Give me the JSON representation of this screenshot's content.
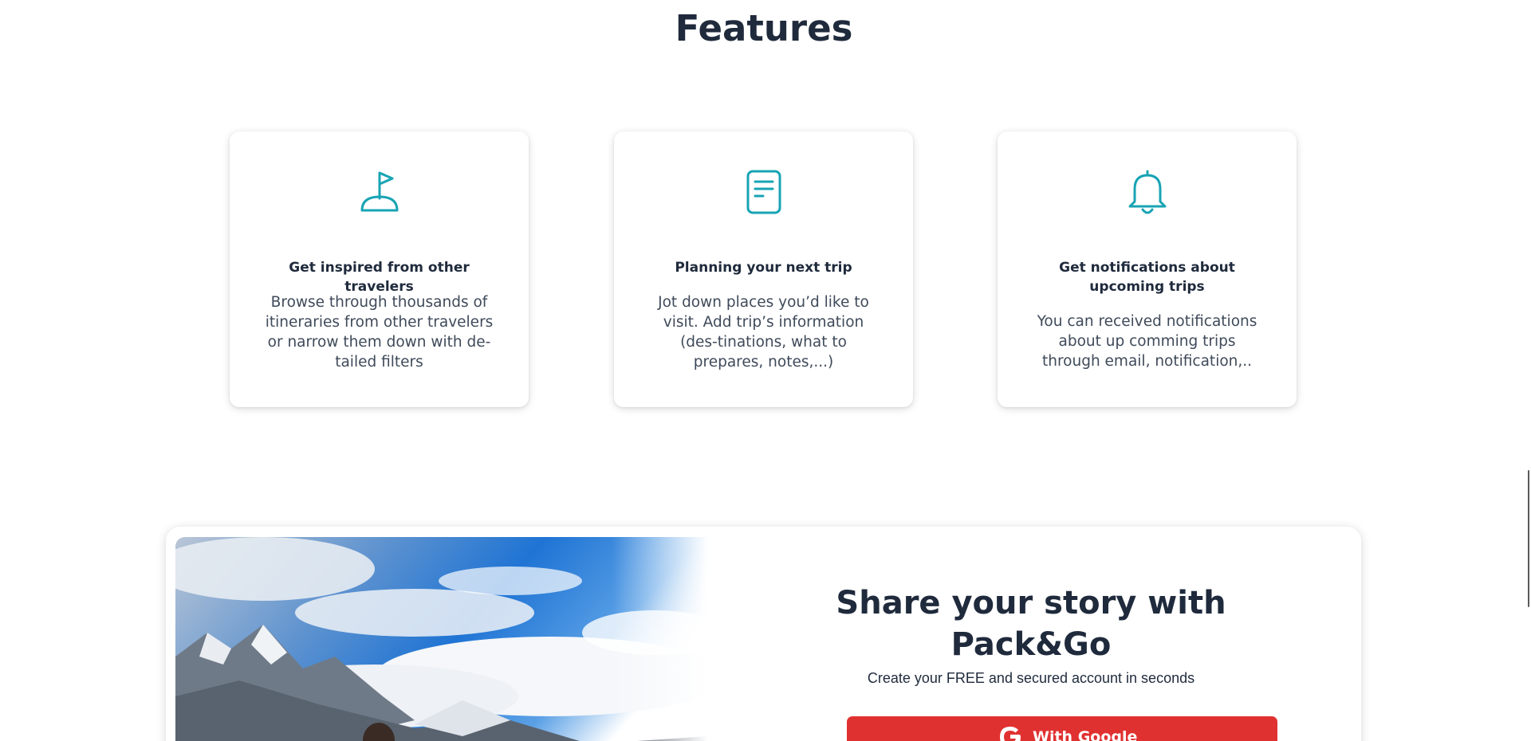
{
  "features": {
    "title": "Features",
    "cards": [
      {
        "icon": "flag-icon",
        "title": "Get inspired from other travelers",
        "description": "Browse through thousands of itineraries from other travelers or narrow them down with de-tailed filters"
      },
      {
        "icon": "document-icon",
        "title": "Planning your next trip",
        "description": "Jot down places you’d like to visit. Add trip’s information (des-tinations, what to prepares, notes,...)"
      },
      {
        "icon": "bell-icon",
        "title": "Get notifications about upcoming trips",
        "description": "You can received notifications about up comming trips through email, notification,.."
      }
    ]
  },
  "cta": {
    "heading": "Share your story with Pack&Go",
    "subheading": "Create your FREE and secured account in seconds",
    "google_button_label": "With Google",
    "image_alt": "hiker-mountain-photo"
  },
  "colors": {
    "accent_teal": "#18a4b4",
    "google_red": "#e03131",
    "text_dark": "#1f2a3c"
  }
}
